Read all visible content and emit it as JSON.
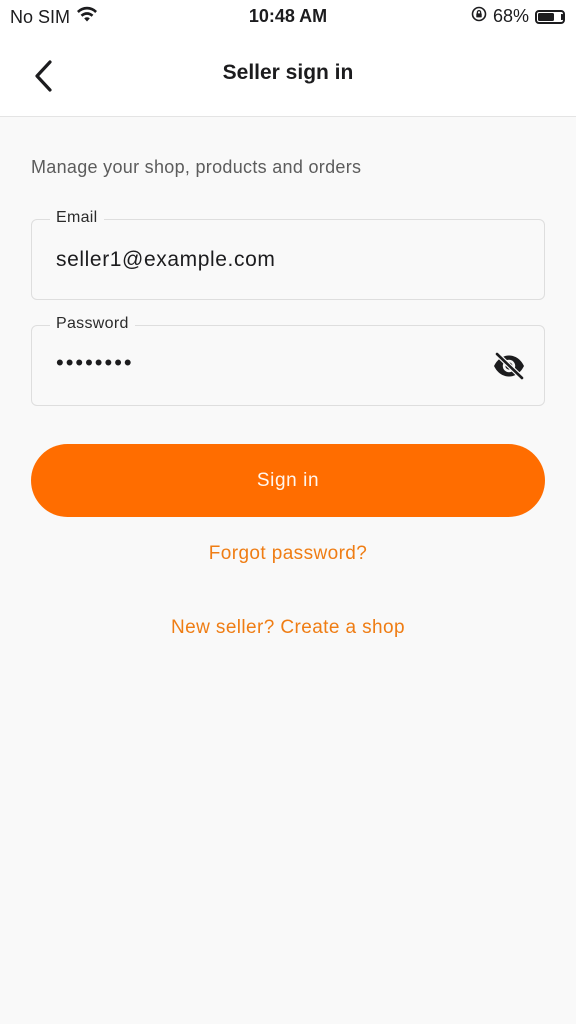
{
  "status_bar": {
    "carrier": "No SIM",
    "time": "10:48 AM",
    "battery_percent": "68%",
    "battery_level": 0.68,
    "icons": [
      "wifi-icon",
      "orientation-lock-icon",
      "battery-icon"
    ]
  },
  "header": {
    "title": "Seller sign in",
    "back_icon": "chevron-left-icon"
  },
  "main": {
    "subtitle": "Manage your shop, products and orders",
    "email": {
      "label": "Email",
      "value": "seller1@example.com"
    },
    "password": {
      "label": "Password",
      "masked_value": "••••••••",
      "toggle_icon": "eye-off-icon"
    },
    "signin_label": "Sign in",
    "forgot_password_label": "Forgot password?",
    "create_shop_label": "New seller? Create a shop"
  },
  "colors": {
    "accent": "#ff6d00",
    "link": "#ef7d14",
    "background": "#f9f9f9",
    "header_bg": "#ffffff"
  }
}
